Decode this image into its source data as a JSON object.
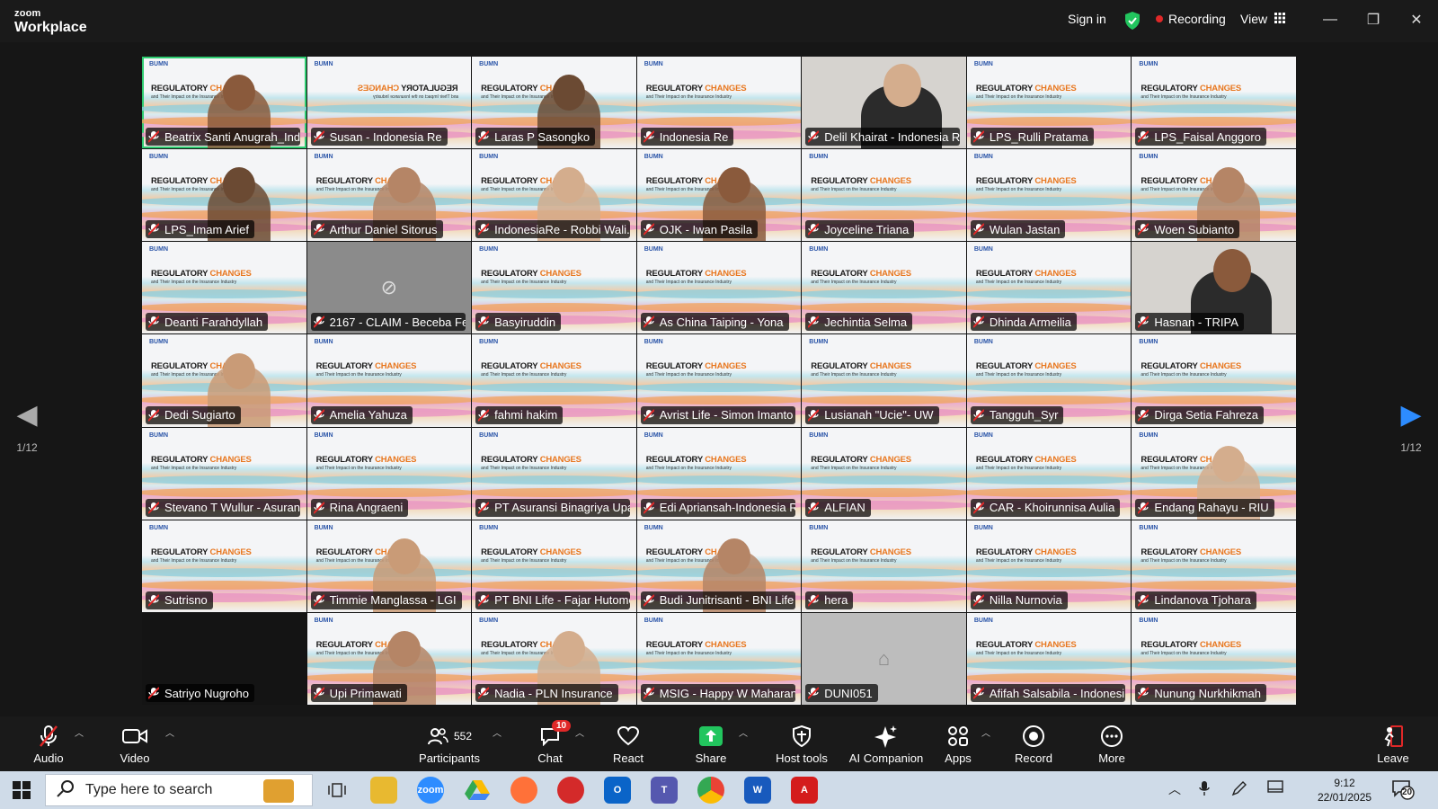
{
  "app": {
    "brand_small": "zoom",
    "brand_big": "Workplace",
    "sign_in": "Sign in",
    "recording": "Recording",
    "view": "View"
  },
  "pagination": {
    "left": "1/12",
    "right": "1/12"
  },
  "slide": {
    "logo": "BUMN",
    "title_a": "REGULATORY ",
    "title_b": "CHANGES",
    "subtitle": "and Their Impact on the Insurance Industry"
  },
  "participants": [
    {
      "name": "Beatrix Santi Anugrah_Ind...",
      "kind": "slide-person",
      "active": true
    },
    {
      "name": "Susan - Indonesia Re",
      "kind": "slide-mirror"
    },
    {
      "name": "Laras P Sasongko",
      "kind": "slide-person"
    },
    {
      "name": "Indonesia Re",
      "kind": "slide"
    },
    {
      "name": "Delil Khairat - Indonesia Re",
      "kind": "photo"
    },
    {
      "name": "LPS_Rulli Pratama",
      "kind": "slide"
    },
    {
      "name": "LPS_Faisal Anggoro",
      "kind": "slide"
    },
    {
      "name": "LPS_Imam Arief",
      "kind": "slide-person"
    },
    {
      "name": "Arthur Daniel Sitorus",
      "kind": "slide-person"
    },
    {
      "name": "IndonesiaRe - Robbi Wali...",
      "kind": "slide-person"
    },
    {
      "name": "OJK - Iwan Pasila",
      "kind": "slide-person"
    },
    {
      "name": "Joyceline Triana",
      "kind": "slide"
    },
    {
      "name": "Wulan Jastan",
      "kind": "slide"
    },
    {
      "name": "Woen Subianto",
      "kind": "slide-person"
    },
    {
      "name": "Deanti Farahdyllah",
      "kind": "slide"
    },
    {
      "name": "2167 - CLAIM - Beceba Fe...",
      "kind": "camoff"
    },
    {
      "name": "Basyiruddin",
      "kind": "slide"
    },
    {
      "name": "As China Taiping - Yona",
      "kind": "slide"
    },
    {
      "name": "Jechintia Selma",
      "kind": "slide"
    },
    {
      "name": "Dhinda Armeilia",
      "kind": "slide"
    },
    {
      "name": "Hasnan - TRIPA",
      "kind": "photo"
    },
    {
      "name": "Dedi Sugiarto",
      "kind": "slide-person"
    },
    {
      "name": "Amelia Yahuza",
      "kind": "slide"
    },
    {
      "name": "fahmi hakim",
      "kind": "slide"
    },
    {
      "name": "Avrist Life - Simon Imanto",
      "kind": "slide"
    },
    {
      "name": "Lusianah \"Ucie\"- UW",
      "kind": "slide"
    },
    {
      "name": "Tangguh_Syr",
      "kind": "slide"
    },
    {
      "name": "Dirga Setia Fahreza",
      "kind": "slide"
    },
    {
      "name": "Stevano T Wullur - Asuran...",
      "kind": "slide"
    },
    {
      "name": "Rina Angraeni",
      "kind": "slide"
    },
    {
      "name": "PT Asuransi Binagriya Upa...",
      "kind": "slide"
    },
    {
      "name": "Edi Apriansah-Indonesia Re",
      "kind": "slide"
    },
    {
      "name": "ALFIAN",
      "kind": "slide"
    },
    {
      "name": "CAR - Khoirunnisa Aulia",
      "kind": "slide"
    },
    {
      "name": "Endang Rahayu - RIU",
      "kind": "slide-person"
    },
    {
      "name": "Sutrisno",
      "kind": "slide"
    },
    {
      "name": "Timmie Manglassa - LGI",
      "kind": "slide-person"
    },
    {
      "name": "PT BNI Life - Fajar Hutomo",
      "kind": "slide"
    },
    {
      "name": "Budi Junitrisanti - BNI Life",
      "kind": "slide-person"
    },
    {
      "name": "hera",
      "kind": "slide"
    },
    {
      "name": "Nilla Nurnovia",
      "kind": "slide"
    },
    {
      "name": "Lindanova Tjohara",
      "kind": "slide"
    },
    {
      "name": "Satriyo Nugroho",
      "kind": "dark"
    },
    {
      "name": "Upi Primawati",
      "kind": "slide-person"
    },
    {
      "name": "Nadia - PLN Insurance",
      "kind": "slide-person"
    },
    {
      "name": "MSIG - Happy W Maharani",
      "kind": "slide"
    },
    {
      "name": "DUNI051",
      "kind": "lgray"
    },
    {
      "name": "Afifah Salsabila - Indonesi...",
      "kind": "slide"
    },
    {
      "name": "Nunung Nurkhikmah",
      "kind": "slide"
    }
  ],
  "toolbar": {
    "audio": "Audio",
    "video": "Video",
    "participants": "Participants",
    "participants_count": "552",
    "chat": "Chat",
    "chat_badge": "10",
    "react": "React",
    "share": "Share",
    "host_tools": "Host tools",
    "ai_companion": "AI Companion",
    "apps": "Apps",
    "record": "Record",
    "more": "More",
    "leave": "Leave"
  },
  "taskbar": {
    "search_placeholder": "Type here to search",
    "time": "9:12",
    "date": "22/01/2025",
    "notif": "20"
  },
  "colors": {
    "accent_blue": "#2d8cff",
    "active_border": "#2ecc71",
    "recording_red": "#e02828",
    "share_green": "#22c55e"
  }
}
